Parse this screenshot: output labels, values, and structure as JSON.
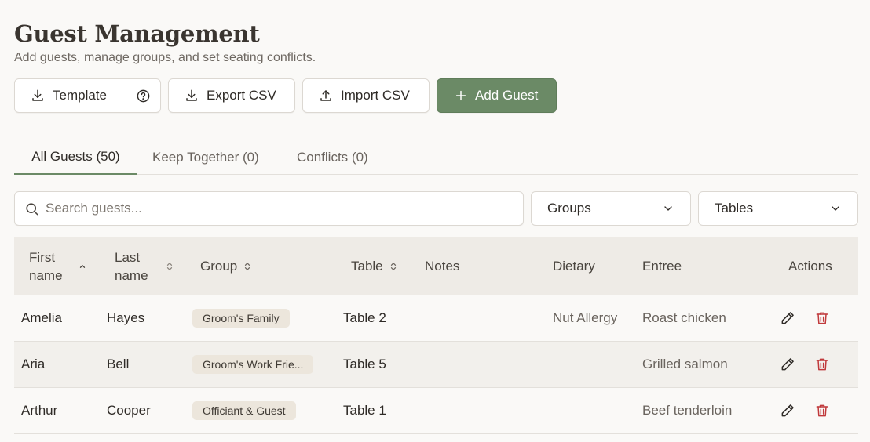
{
  "header": {
    "title": "Guest Management",
    "subtitle": "Add guests, manage groups, and set seating conflicts."
  },
  "toolbar": {
    "template_label": "Template",
    "export_label": "Export CSV",
    "import_label": "Import CSV",
    "add_label": "Add Guest"
  },
  "tabs": [
    {
      "label": "All Guests (50)",
      "active": true
    },
    {
      "label": "Keep Together (0)",
      "active": false
    },
    {
      "label": "Conflicts (0)",
      "active": false
    }
  ],
  "filters": {
    "search_placeholder": "Search guests...",
    "groups_label": "Groups",
    "tables_label": "Tables"
  },
  "table": {
    "headers": {
      "first_1": "First",
      "first_2": "name",
      "last_1": "Last",
      "last_2": "name",
      "group": "Group",
      "table": "Table",
      "notes": "Notes",
      "dietary": "Dietary",
      "entree": "Entree",
      "actions": "Actions"
    },
    "rows": [
      {
        "first": "Amelia",
        "last": "Hayes",
        "group": "Groom's Family",
        "table": "Table 2",
        "notes": "",
        "dietary": "Nut Allergy",
        "entree": "Roast chicken"
      },
      {
        "first": "Aria",
        "last": "Bell",
        "group": "Groom's Work Frie...",
        "table": "Table 5",
        "notes": "",
        "dietary": "",
        "entree": "Grilled salmon"
      },
      {
        "first": "Arthur",
        "last": "Cooper",
        "group": "Officiant & Guest",
        "table": "Table 1",
        "notes": "",
        "dietary": "",
        "entree": "Beef tenderloin"
      }
    ]
  },
  "colors": {
    "accent": "#6b8a66",
    "delete": "#c0393b",
    "badge_bg": "#ece6dc"
  }
}
